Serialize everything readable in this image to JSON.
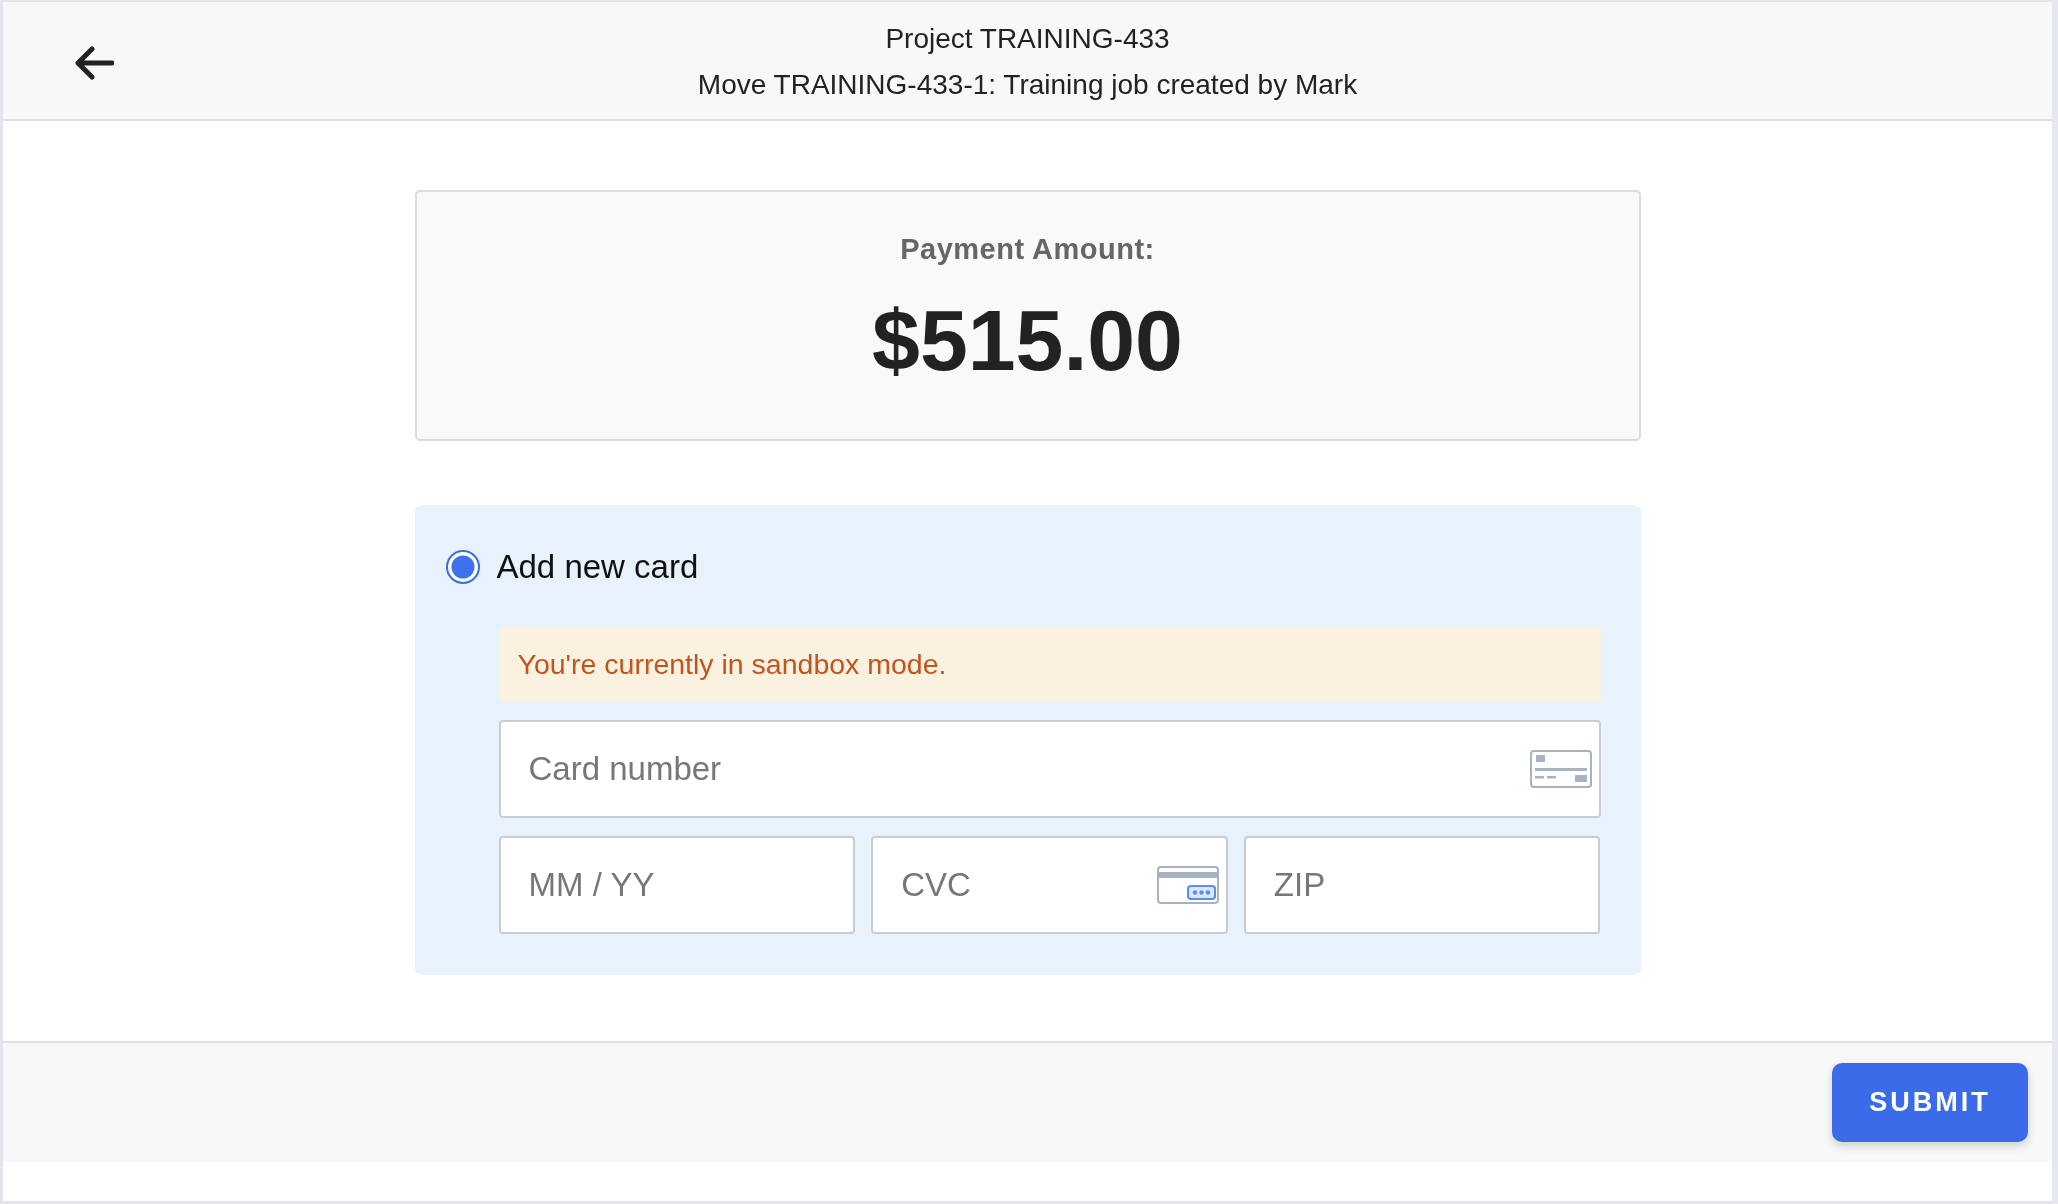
{
  "header": {
    "title": "Project TRAINING-433",
    "subtitle": "Move TRAINING-433-1: Training job created by Mark"
  },
  "payment": {
    "label": "Payment Amount:",
    "amount": "$515.00"
  },
  "payment_option": {
    "label": "Add new card",
    "selected": true,
    "notice": "You're currently in sandbox mode.",
    "fields": [
      {
        "kind": "card_number",
        "placeholder": "Card number"
      },
      {
        "kind": "expiry",
        "placeholder": "MM / YY"
      },
      {
        "kind": "cvc",
        "placeholder": "CVC"
      },
      {
        "kind": "zip",
        "placeholder": "ZIP"
      }
    ]
  },
  "footer": {
    "submit": "SUBMIT"
  }
}
